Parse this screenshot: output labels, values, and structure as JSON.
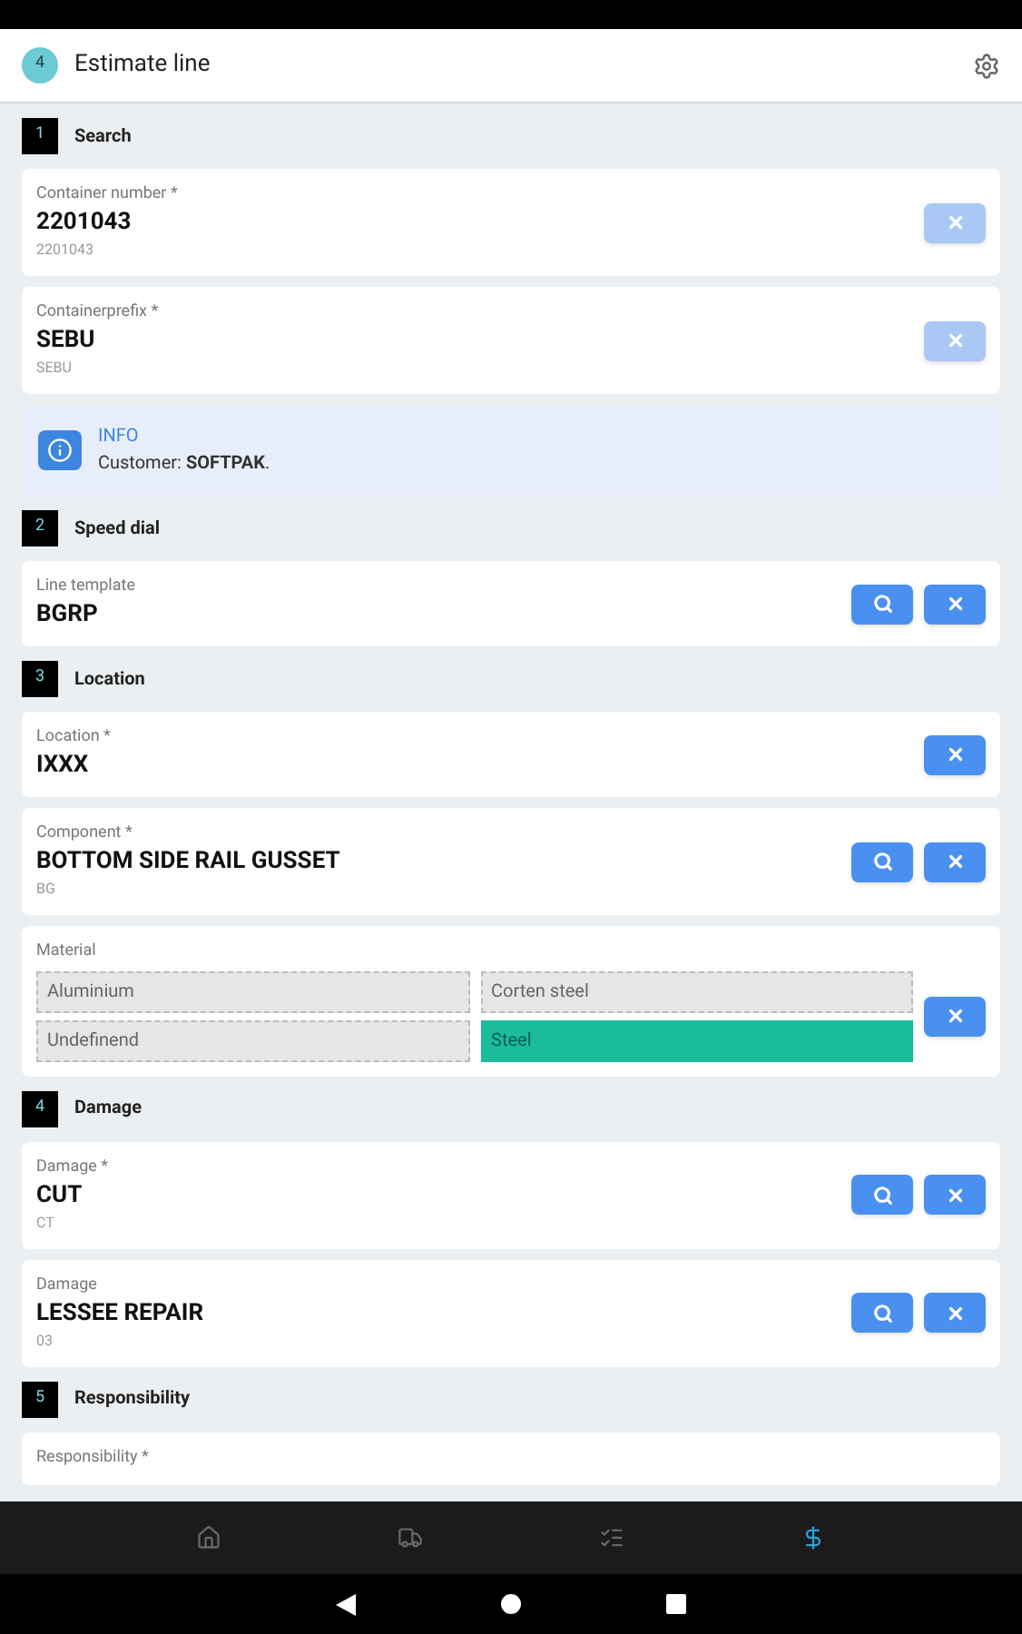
{
  "header": {
    "step": "4",
    "title": "Estimate line"
  },
  "sections": [
    {
      "number": "1",
      "title": "Search",
      "cards": [
        {
          "kind": "field",
          "label": "Container number *",
          "value": "2201043",
          "sub": "2201043",
          "search": false,
          "disabled": true
        },
        {
          "kind": "field",
          "label": "Containerprefix *",
          "value": "SEBU",
          "sub": "SEBU",
          "search": false,
          "disabled": true
        },
        {
          "kind": "info",
          "title": "INFO",
          "text": "Customer: **SOFTPAK**."
        }
      ]
    },
    {
      "number": "2",
      "title": "Speed dial",
      "cards": [
        {
          "kind": "field",
          "label": "Line template",
          "value": "BGRP",
          "search": true,
          "disabled": false
        }
      ]
    },
    {
      "number": "3",
      "title": "Location",
      "cards": [
        {
          "kind": "field",
          "label": "Location *",
          "value": "IXXX",
          "search": false,
          "disabled": false
        },
        {
          "kind": "field",
          "label": "Component *",
          "value": "BOTTOM SIDE RAIL GUSSET",
          "sub": "BG",
          "search": true,
          "disabled": false
        },
        {
          "kind": "material",
          "label": "Material",
          "options": [
            {
              "label": "Aluminium",
              "selected": false
            },
            {
              "label": "Corten steel",
              "selected": false
            },
            {
              "label": "Undefinend",
              "selected": false
            },
            {
              "label": "Steel",
              "selected": true
            }
          ]
        }
      ]
    },
    {
      "number": "4",
      "title": "Damage",
      "cards": [
        {
          "kind": "field",
          "label": "Damage *",
          "value": "CUT",
          "sub": "CT",
          "search": true,
          "disabled": false
        },
        {
          "kind": "field",
          "label": "Damage",
          "value": "LESSEE REPAIR",
          "sub": "03",
          "search": true,
          "disabled": false
        }
      ]
    },
    {
      "number": "5",
      "title": "Responsibility",
      "cards": [
        {
          "kind": "field",
          "label": "Responsibility *",
          "search": false
        }
      ]
    }
  ],
  "nav": [
    {
      "kind": "home",
      "selected": false
    },
    {
      "kind": "truck",
      "selected": false
    },
    {
      "kind": "list",
      "selected": false
    },
    {
      "kind": "dollar",
      "selected": true
    }
  ]
}
